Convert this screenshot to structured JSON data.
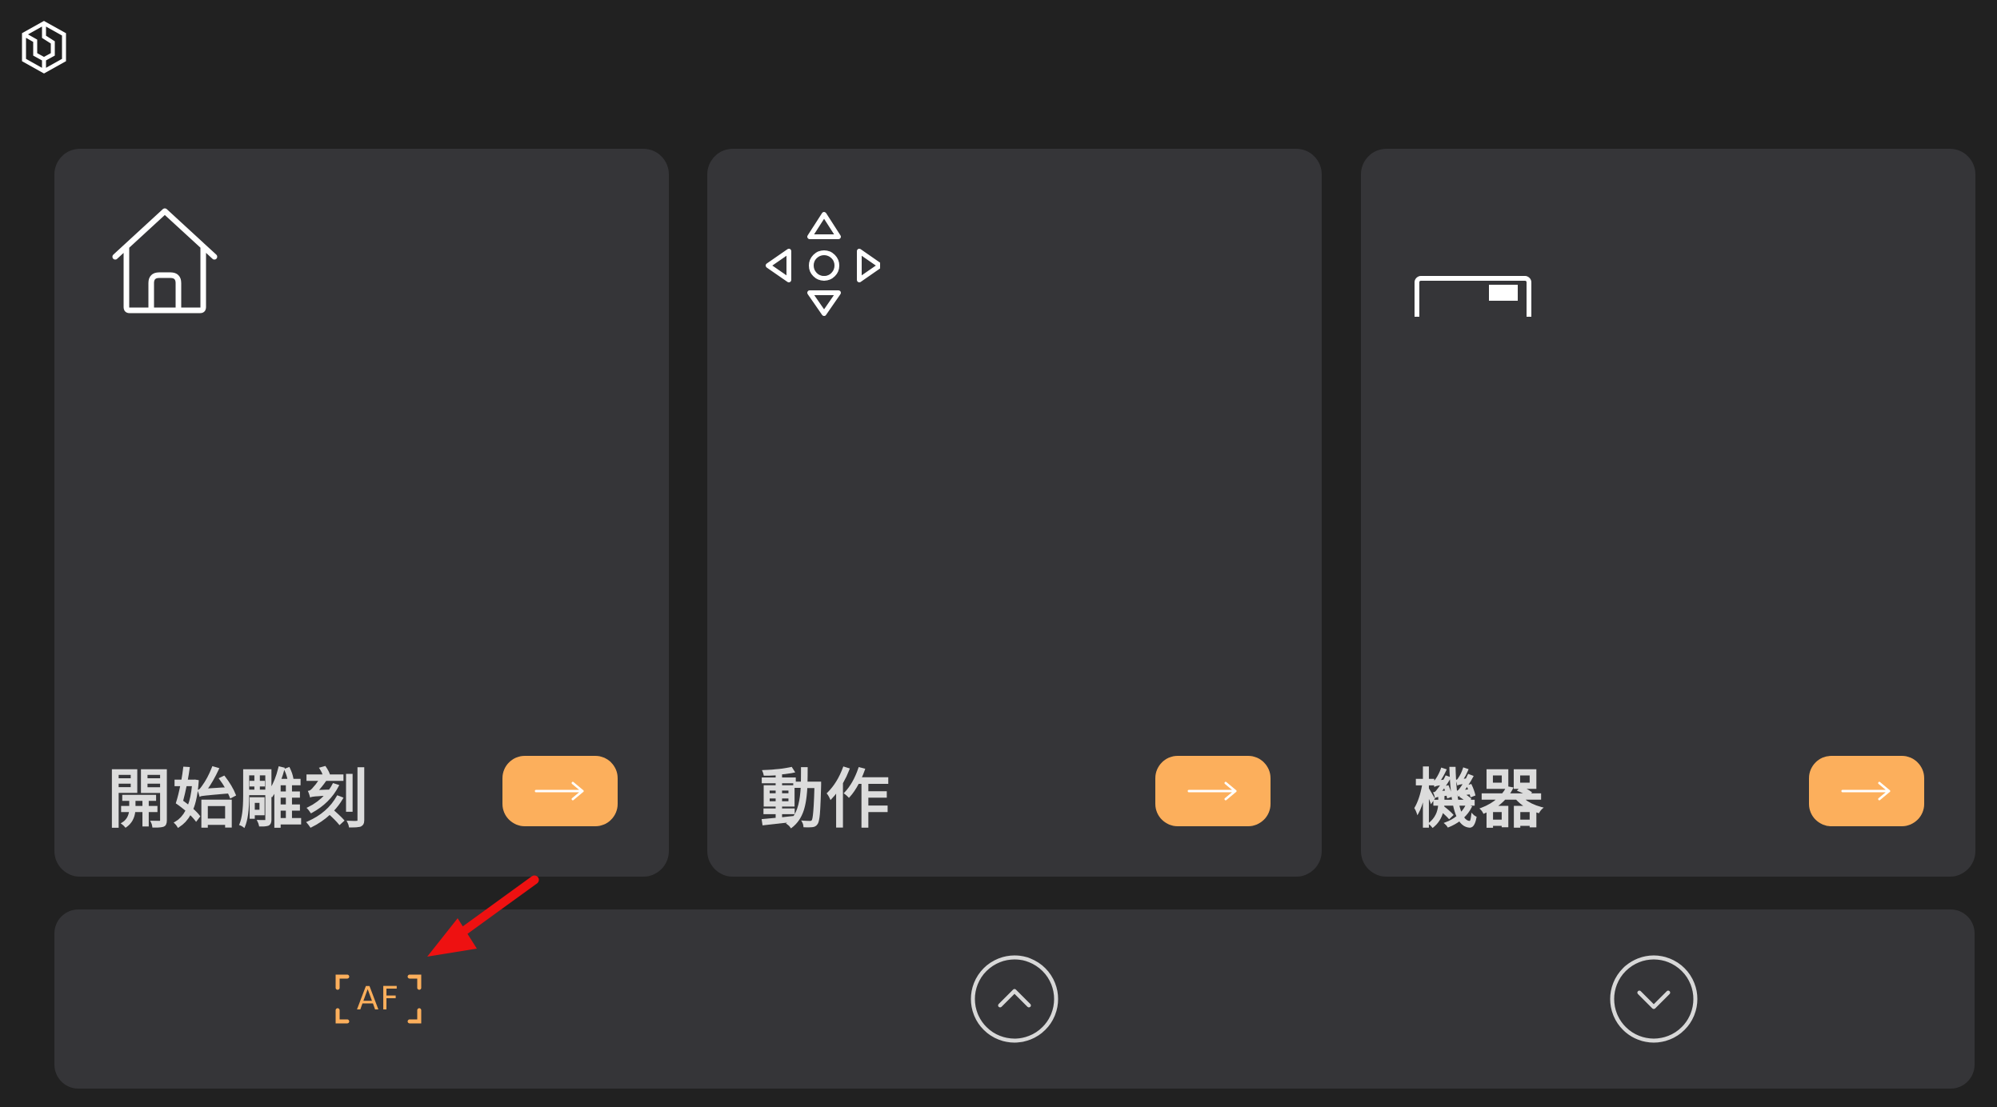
{
  "app": {
    "logo_icon": "hexagon-logo-icon"
  },
  "cards": [
    {
      "label": "開始雕刻",
      "icon": "home-icon",
      "arrow_icon": "arrow-right-icon"
    },
    {
      "label": "動作",
      "icon": "dpad-move-icon",
      "arrow_icon": "arrow-right-icon"
    },
    {
      "label": "機器",
      "icon": "machine-icon",
      "arrow_icon": "arrow-right-icon"
    }
  ],
  "bottom_bar": {
    "af_label": "AF",
    "up_icon": "chevron-up-circle-icon",
    "down_icon": "chevron-down-circle-icon"
  },
  "colors": {
    "background": "#212121",
    "card": "#353538",
    "accent": "#fcaf5c",
    "text": "#dcdcdc",
    "annotation": "#ee1111"
  }
}
